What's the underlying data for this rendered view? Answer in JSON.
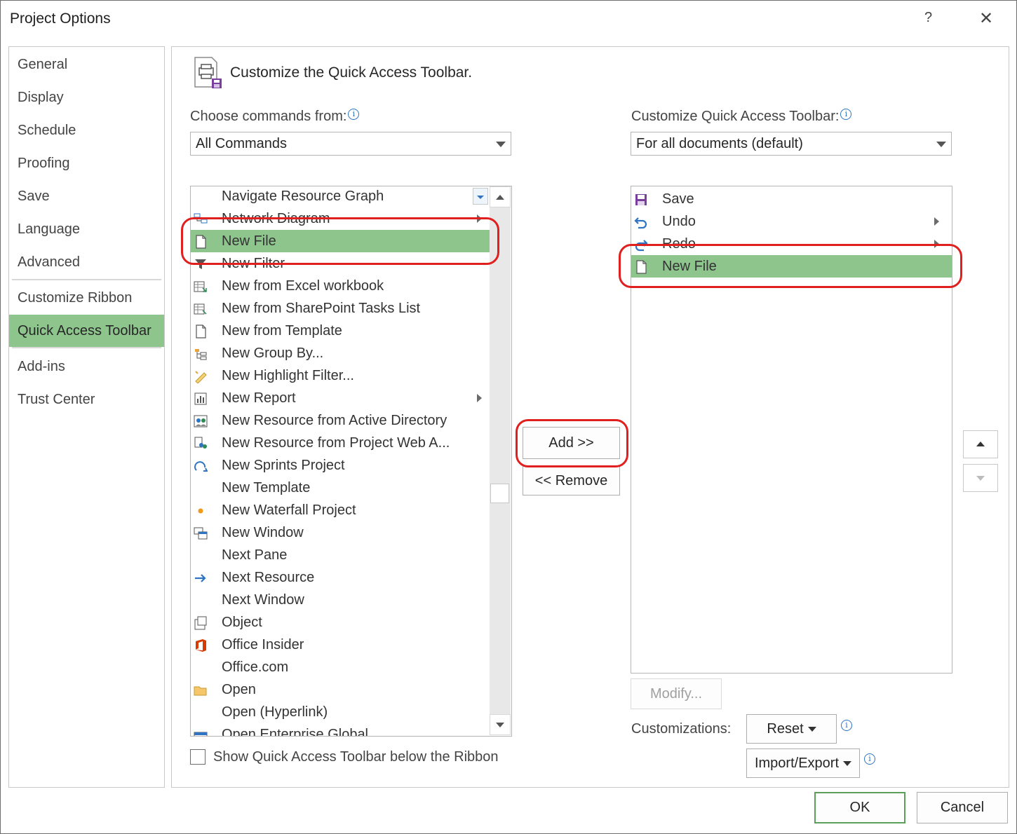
{
  "window": {
    "title": "Project Options",
    "help_label": "?",
    "close_label": "✕"
  },
  "nav": {
    "items": [
      "General",
      "Display",
      "Schedule",
      "Proofing",
      "Save",
      "Language",
      "Advanced",
      "Customize Ribbon",
      "Quick Access Toolbar",
      "Add-ins",
      "Trust Center"
    ],
    "selected": "Quick Access Toolbar"
  },
  "header": {
    "title": "Customize the Quick Access Toolbar."
  },
  "choose": {
    "label": "Choose commands from:",
    "selected": "All Commands"
  },
  "customize": {
    "label": "Customize Quick Access Toolbar:",
    "selected": "For all documents (default)"
  },
  "commands_list": [
    {
      "label": "Navigate Resource Graph",
      "icon": "blank"
    },
    {
      "label": "Network Diagram",
      "icon": "network-diagram-icon",
      "submenu": true
    },
    {
      "label": "New File",
      "icon": "blank-page-icon",
      "selected": true
    },
    {
      "label": "New Filter",
      "icon": "filter-icon"
    },
    {
      "label": "New from Excel workbook",
      "icon": "excel-import-icon"
    },
    {
      "label": "New from SharePoint Tasks List",
      "icon": "sharepoint-tasks-icon"
    },
    {
      "label": "New from Template",
      "icon": "blank-page-icon"
    },
    {
      "label": "New Group By...",
      "icon": "group-by-icon"
    },
    {
      "label": "New Highlight Filter...",
      "icon": "highlight-icon"
    },
    {
      "label": "New Report",
      "icon": "report-icon",
      "submenu": true
    },
    {
      "label": "New Resource from Active Directory",
      "icon": "active-directory-icon"
    },
    {
      "label": "New Resource from Project Web A...",
      "icon": "project-web-icon"
    },
    {
      "label": "New Sprints Project",
      "icon": "sprints-icon"
    },
    {
      "label": "New Template",
      "icon": "blank"
    },
    {
      "label": "New Waterfall Project",
      "icon": "dot-icon"
    },
    {
      "label": "New Window",
      "icon": "new-window-icon"
    },
    {
      "label": "Next Pane",
      "icon": "blank"
    },
    {
      "label": "Next Resource",
      "icon": "arrow-right-icon"
    },
    {
      "label": "Next Window",
      "icon": "blank"
    },
    {
      "label": "Object",
      "icon": "object-icon"
    },
    {
      "label": "Office Insider",
      "icon": "office-logo-icon"
    },
    {
      "label": "Office.com",
      "icon": "blank"
    },
    {
      "label": "Open",
      "icon": "folder-icon"
    },
    {
      "label": "Open (Hyperlink)",
      "icon": "blank"
    },
    {
      "label": "Open Enterprise Global",
      "icon": "enterprise-icon"
    }
  ],
  "toolbar_list": [
    {
      "label": "Save",
      "icon": "save-icon"
    },
    {
      "label": "Undo",
      "icon": "undo-icon",
      "submenu": true
    },
    {
      "label": "Redo",
      "icon": "redo-icon",
      "submenu": true
    },
    {
      "label": "New File",
      "icon": "blank-page-icon",
      "selected": true
    }
  ],
  "buttons": {
    "add": "Add >>",
    "remove": "<< Remove",
    "modify": "Modify...",
    "reset": "Reset",
    "import_export": "Import/Export",
    "ok": "OK",
    "cancel": "Cancel"
  },
  "customizations_label": "Customizations:",
  "show_below_label": "Show Quick Access Toolbar below the Ribbon",
  "colors": {
    "selection": "#8dc58d",
    "callout": "#e01f1f",
    "accent_blue": "#2e74c2"
  }
}
